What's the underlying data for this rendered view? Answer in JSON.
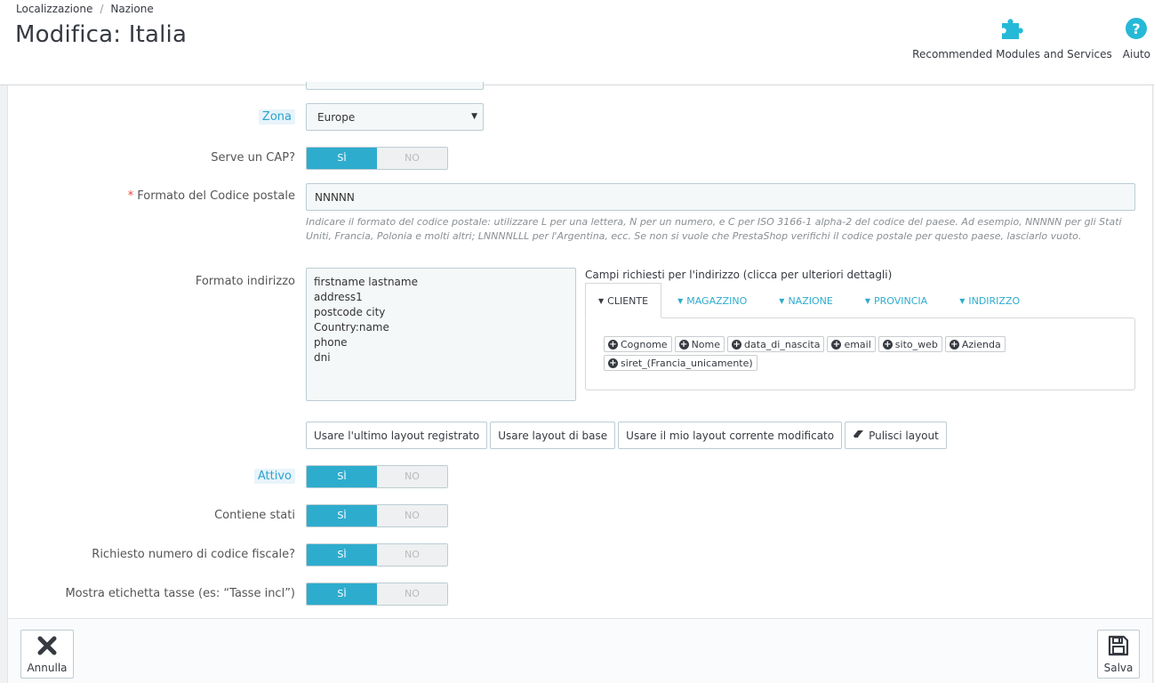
{
  "breadcrumb": {
    "parent": "Localizzazione",
    "current": "Nazione"
  },
  "page_title": "Modifica: Italia",
  "toolbar": {
    "modules_label": "Recommended Modules and Services",
    "help_label": "Aiuto"
  },
  "form": {
    "zone": {
      "label": "Zona",
      "value": "Europe"
    },
    "zip_required": {
      "label": "Serve un CAP?",
      "on": "SÌ",
      "off": "NO"
    },
    "zip_format": {
      "label": "Formato del Codice postale",
      "required_mark": "*",
      "value": "NNNNN",
      "help": "Indicare il formato del codice postale: utilizzare L per una lettera, N per un numero, e C per ISO 3166-1 alpha-2 del codice del paese. Ad esempio, NNNNN per gli Stati Uniti, Francia, Polonia e molti altri; LNNNNLLL per l'Argentina, ecc. Se non si vuole che PrestaShop verifichi il codice postale per questo paese, lasciarlo vuoto."
    },
    "address_format": {
      "label": "Formato indirizzo",
      "lines": [
        "firstname lastname",
        "address1",
        "postcode city",
        "Country:name",
        "phone",
        "dni"
      ],
      "fields_title": "Campi richiesti per l'indirizzo (clicca per ulteriori dettagli)",
      "tabs": [
        "CLIENTE",
        "MAGAZZINO",
        "NAZIONE",
        "PROVINCIA",
        "INDIRIZZO"
      ],
      "active_tab": "CLIENTE",
      "tags": [
        "Cognome",
        "Nome",
        "data_di_nascita",
        "email",
        "sito_web",
        "Azienda",
        "siret_(Francia_unicamente)"
      ],
      "buttons": {
        "last_saved": "Usare l'ultimo layout registrato",
        "default": "Usare layout di base",
        "current": "Usare il mio layout corrente modificato",
        "clear": "Pulisci layout"
      }
    },
    "active": {
      "label": "Attivo",
      "on": "SÌ",
      "off": "NO"
    },
    "contains_states": {
      "label": "Contiene stati",
      "on": "SÌ",
      "off": "NO"
    },
    "need_id_number": {
      "label": "Richiesto numero di codice fiscale?",
      "on": "SÌ",
      "off": "NO"
    },
    "display_tax_label": {
      "label": "Mostra etichetta tasse (es: “Tasse incl”)",
      "on": "SÌ",
      "off": "NO"
    }
  },
  "footer": {
    "cancel_label": "Annulla",
    "save_label": "Salva"
  },
  "colors": {
    "accent": "#2eacce",
    "switch_on": "#2eacce",
    "required": "#e24b3b",
    "icon_blue": "#25b9d7"
  }
}
